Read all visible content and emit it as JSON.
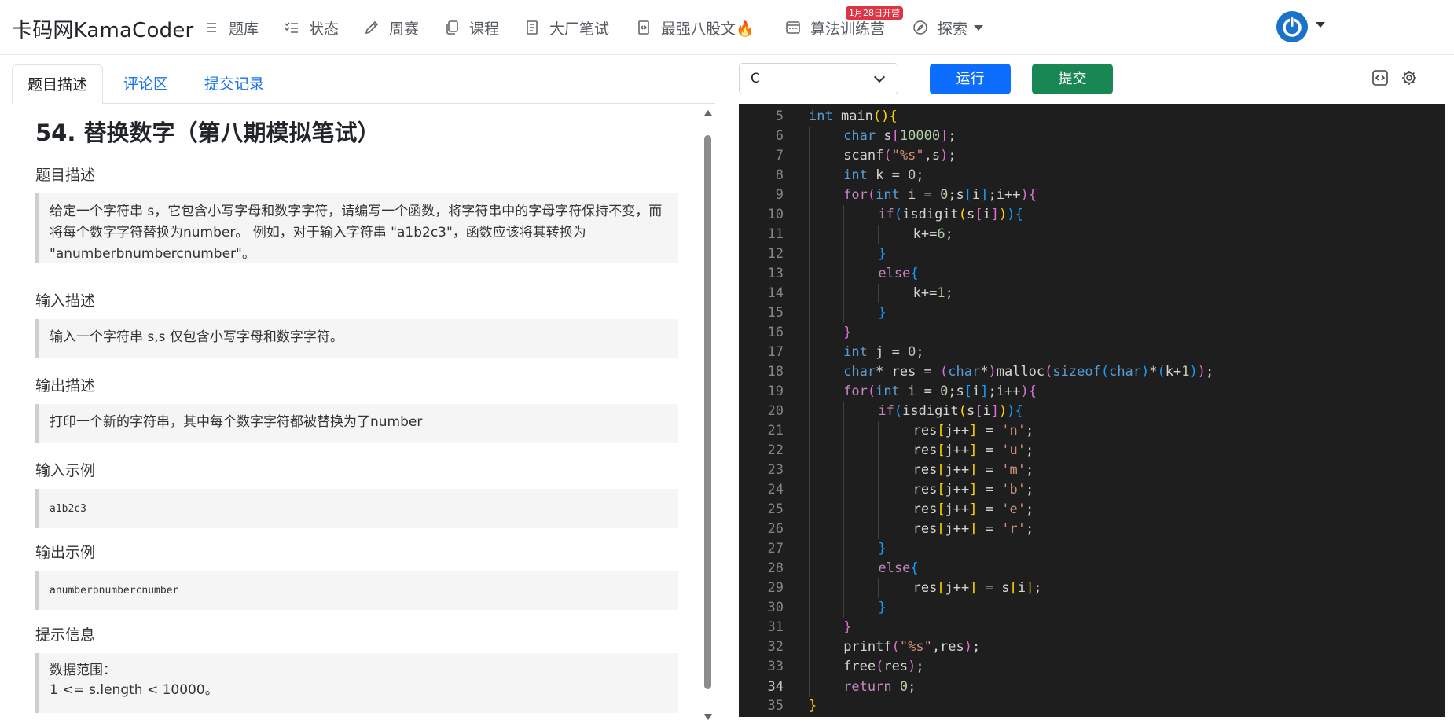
{
  "navbar": {
    "brand": "卡码网KamaCoder",
    "items": [
      {
        "label": "题库",
        "icon": "list-icon"
      },
      {
        "label": "状态",
        "icon": "checklist-icon"
      },
      {
        "label": "周赛",
        "icon": "pencil-icon"
      },
      {
        "label": "课程",
        "icon": "copy-icon"
      },
      {
        "label": "大厂笔试",
        "icon": "document-icon"
      },
      {
        "label": "最强八股文🔥",
        "icon": "code-file-icon"
      },
      {
        "label": "算法训练营",
        "icon": "terminal-window-icon"
      },
      {
        "label": "探索",
        "icon": "compass-icon"
      }
    ],
    "badge": "1月28日开营"
  },
  "tabs": [
    "题目描述",
    "评论区",
    "提交记录"
  ],
  "problem": {
    "title": "54. 替换数字（第八期模拟笔试）",
    "sections": [
      {
        "label": "题目描述",
        "text": "给定一个字符串 s，它包含小写字母和数字字符，请编写一个函数，将字符串中的字母字符保持不变，而将每个数字字符替换为number。 例如，对于输入字符串 \"a1b2c3\"，函数应该将其转换为 \"anumberbnumbercnumber\"。"
      },
      {
        "label": "输入描述",
        "text": "输入一个字符串 s,s 仅包含小写字母和数字字符。"
      },
      {
        "label": "输出描述",
        "text": "打印一个新的字符串，其中每个数字字符都被替换为了number"
      },
      {
        "label": "输入示例",
        "text": "a1b2c3"
      },
      {
        "label": "输出示例",
        "text": "anumberbnumbercnumber"
      },
      {
        "label": "提示信息",
        "text": "数据范围：",
        "text2": "1 <= s.length < 10000。"
      }
    ]
  },
  "editor": {
    "language": "C",
    "run_label": "运行",
    "submit_label": "提交",
    "current_line": 34,
    "colors": {
      "background": "#1e1e1e",
      "run": "#0d6efd",
      "submit": "#198754"
    },
    "lines": [
      {
        "n": "5",
        "indent": 0,
        "tokens": [
          [
            "int",
            "k-type"
          ],
          [
            " main",
            ""
          ],
          [
            "(",
            "b1"
          ],
          [
            ")",
            "b1"
          ],
          [
            "{",
            "b1"
          ]
        ]
      },
      {
        "n": "6",
        "indent": 1,
        "tokens": [
          [
            "char",
            "k-type"
          ],
          [
            " s",
            ""
          ],
          [
            "[",
            "b2"
          ],
          [
            "10000",
            "k-num"
          ],
          [
            "]",
            "b2"
          ],
          [
            ";",
            ""
          ]
        ]
      },
      {
        "n": "7",
        "indent": 1,
        "tokens": [
          [
            "scanf",
            ""
          ],
          [
            "(",
            "b2"
          ],
          [
            "\"%s\"",
            "k-str"
          ],
          [
            ",s",
            ""
          ],
          [
            ")",
            "b2"
          ],
          [
            ";",
            ""
          ]
        ]
      },
      {
        "n": "8",
        "indent": 1,
        "tokens": [
          [
            "int",
            "k-type"
          ],
          [
            " k = ",
            ""
          ],
          [
            "0",
            "k-num"
          ],
          [
            ";",
            ""
          ]
        ]
      },
      {
        "n": "9",
        "indent": 1,
        "tokens": [
          [
            "for",
            "k-ctrl"
          ],
          [
            "(",
            "b2"
          ],
          [
            "int",
            "k-type"
          ],
          [
            " i = ",
            ""
          ],
          [
            "0",
            "k-num"
          ],
          [
            ";s",
            ""
          ],
          [
            "[",
            "b3"
          ],
          [
            "i",
            ""
          ],
          [
            "]",
            "b3"
          ],
          [
            ";i++",
            ""
          ],
          [
            ")",
            "b2"
          ],
          [
            "{",
            "b2"
          ]
        ]
      },
      {
        "n": "10",
        "indent": 2,
        "tokens": [
          [
            "if",
            "k-ctrl"
          ],
          [
            "(",
            "b3"
          ],
          [
            "isdigit",
            ""
          ],
          [
            "(",
            "b1"
          ],
          [
            "s",
            ""
          ],
          [
            "[",
            "b2"
          ],
          [
            "i",
            ""
          ],
          [
            "]",
            "b2"
          ],
          [
            ")",
            "b1"
          ],
          [
            ")",
            "b3"
          ],
          [
            "{",
            "b3"
          ]
        ]
      },
      {
        "n": "11",
        "indent": 3,
        "tokens": [
          [
            "k+=",
            ""
          ],
          [
            "6",
            "k-num"
          ],
          [
            ";",
            ""
          ]
        ]
      },
      {
        "n": "12",
        "indent": 2,
        "tokens": [
          [
            "}",
            "b3"
          ]
        ]
      },
      {
        "n": "13",
        "indent": 2,
        "tokens": [
          [
            "else",
            "k-ctrl"
          ],
          [
            "{",
            "b3"
          ]
        ]
      },
      {
        "n": "14",
        "indent": 3,
        "tokens": [
          [
            "k+=",
            ""
          ],
          [
            "1",
            "k-num"
          ],
          [
            ";",
            ""
          ]
        ]
      },
      {
        "n": "15",
        "indent": 2,
        "tokens": [
          [
            "}",
            "b3"
          ]
        ]
      },
      {
        "n": "16",
        "indent": 1,
        "tokens": [
          [
            "}",
            "b2"
          ]
        ]
      },
      {
        "n": "17",
        "indent": 1,
        "tokens": [
          [
            "int",
            "k-type"
          ],
          [
            " j = ",
            ""
          ],
          [
            "0",
            "k-num"
          ],
          [
            ";",
            ""
          ]
        ]
      },
      {
        "n": "18",
        "indent": 1,
        "tokens": [
          [
            "char",
            "k-type"
          ],
          [
            "* res = ",
            ""
          ],
          [
            "(",
            "b2"
          ],
          [
            "char",
            "k-type"
          ],
          [
            "*",
            ""
          ],
          [
            ")",
            "b2"
          ],
          [
            "malloc",
            ""
          ],
          [
            "(",
            "b2"
          ],
          [
            "sizeof",
            "k-type"
          ],
          [
            "(",
            "b3"
          ],
          [
            "char",
            "k-type"
          ],
          [
            ")",
            "b3"
          ],
          [
            "*",
            ""
          ],
          [
            "(",
            "b3"
          ],
          [
            "k+",
            ""
          ],
          [
            "1",
            "k-num"
          ],
          [
            ")",
            "b3"
          ],
          [
            ")",
            "b2"
          ],
          [
            ";",
            ""
          ]
        ]
      },
      {
        "n": "19",
        "indent": 1,
        "tokens": [
          [
            "for",
            "k-ctrl"
          ],
          [
            "(",
            "b2"
          ],
          [
            "int",
            "k-type"
          ],
          [
            " i = ",
            ""
          ],
          [
            "0",
            "k-num"
          ],
          [
            ";s",
            ""
          ],
          [
            "[",
            "b3"
          ],
          [
            "i",
            ""
          ],
          [
            "]",
            "b3"
          ],
          [
            ";i++",
            ""
          ],
          [
            ")",
            "b2"
          ],
          [
            "{",
            "b2"
          ]
        ]
      },
      {
        "n": "20",
        "indent": 2,
        "tokens": [
          [
            "if",
            "k-ctrl"
          ],
          [
            "(",
            "b3"
          ],
          [
            "isdigit",
            ""
          ],
          [
            "(",
            "b1"
          ],
          [
            "s",
            ""
          ],
          [
            "[",
            "b2"
          ],
          [
            "i",
            ""
          ],
          [
            "]",
            "b2"
          ],
          [
            ")",
            "b1"
          ],
          [
            ")",
            "b3"
          ],
          [
            "{",
            "b3"
          ]
        ]
      },
      {
        "n": "21",
        "indent": 3,
        "tokens": [
          [
            "res",
            ""
          ],
          [
            "[",
            "b1"
          ],
          [
            "j++",
            ""
          ],
          [
            "]",
            "b1"
          ],
          [
            " = ",
            ""
          ],
          [
            "'n'",
            "k-str"
          ],
          [
            ";",
            ""
          ]
        ]
      },
      {
        "n": "22",
        "indent": 3,
        "tokens": [
          [
            "res",
            ""
          ],
          [
            "[",
            "b1"
          ],
          [
            "j++",
            ""
          ],
          [
            "]",
            "b1"
          ],
          [
            " = ",
            ""
          ],
          [
            "'u'",
            "k-str"
          ],
          [
            ";",
            ""
          ]
        ]
      },
      {
        "n": "23",
        "indent": 3,
        "tokens": [
          [
            "res",
            ""
          ],
          [
            "[",
            "b1"
          ],
          [
            "j++",
            ""
          ],
          [
            "]",
            "b1"
          ],
          [
            " = ",
            ""
          ],
          [
            "'m'",
            "k-str"
          ],
          [
            ";",
            ""
          ]
        ]
      },
      {
        "n": "24",
        "indent": 3,
        "tokens": [
          [
            "res",
            ""
          ],
          [
            "[",
            "b1"
          ],
          [
            "j++",
            ""
          ],
          [
            "]",
            "b1"
          ],
          [
            " = ",
            ""
          ],
          [
            "'b'",
            "k-str"
          ],
          [
            ";",
            ""
          ]
        ]
      },
      {
        "n": "25",
        "indent": 3,
        "tokens": [
          [
            "res",
            ""
          ],
          [
            "[",
            "b1"
          ],
          [
            "j++",
            ""
          ],
          [
            "]",
            "b1"
          ],
          [
            " = ",
            ""
          ],
          [
            "'e'",
            "k-str"
          ],
          [
            ";",
            ""
          ]
        ]
      },
      {
        "n": "26",
        "indent": 3,
        "tokens": [
          [
            "res",
            ""
          ],
          [
            "[",
            "b1"
          ],
          [
            "j++",
            ""
          ],
          [
            "]",
            "b1"
          ],
          [
            " = ",
            ""
          ],
          [
            "'r'",
            "k-str"
          ],
          [
            ";",
            ""
          ]
        ]
      },
      {
        "n": "27",
        "indent": 2,
        "tokens": [
          [
            "}",
            "b3"
          ]
        ]
      },
      {
        "n": "28",
        "indent": 2,
        "tokens": [
          [
            "else",
            "k-ctrl"
          ],
          [
            "{",
            "b3"
          ]
        ]
      },
      {
        "n": "29",
        "indent": 3,
        "tokens": [
          [
            "res",
            ""
          ],
          [
            "[",
            "b1"
          ],
          [
            "j++",
            ""
          ],
          [
            "]",
            "b1"
          ],
          [
            " = s",
            ""
          ],
          [
            "[",
            "b1"
          ],
          [
            "i",
            ""
          ],
          [
            "]",
            "b1"
          ],
          [
            ";",
            ""
          ]
        ]
      },
      {
        "n": "30",
        "indent": 2,
        "tokens": [
          [
            "}",
            "b3"
          ]
        ]
      },
      {
        "n": "31",
        "indent": 1,
        "tokens": [
          [
            "}",
            "b2"
          ]
        ]
      },
      {
        "n": "32",
        "indent": 1,
        "tokens": [
          [
            "printf",
            ""
          ],
          [
            "(",
            "b2"
          ],
          [
            "\"%s\"",
            "k-str"
          ],
          [
            ",res",
            ""
          ],
          [
            ")",
            "b2"
          ],
          [
            ";",
            ""
          ]
        ]
      },
      {
        "n": "33",
        "indent": 1,
        "tokens": [
          [
            "free",
            ""
          ],
          [
            "(",
            "b2"
          ],
          [
            "res",
            ""
          ],
          [
            ")",
            "b2"
          ],
          [
            ";",
            ""
          ]
        ]
      },
      {
        "n": "34",
        "indent": 1,
        "tokens": [
          [
            "return",
            "k-ctrl"
          ],
          [
            " ",
            ""
          ],
          [
            "0",
            "k-num"
          ],
          [
            ";",
            ""
          ]
        ]
      },
      {
        "n": "35",
        "indent": 0,
        "tokens": [
          [
            "}",
            "b1"
          ]
        ]
      }
    ]
  }
}
